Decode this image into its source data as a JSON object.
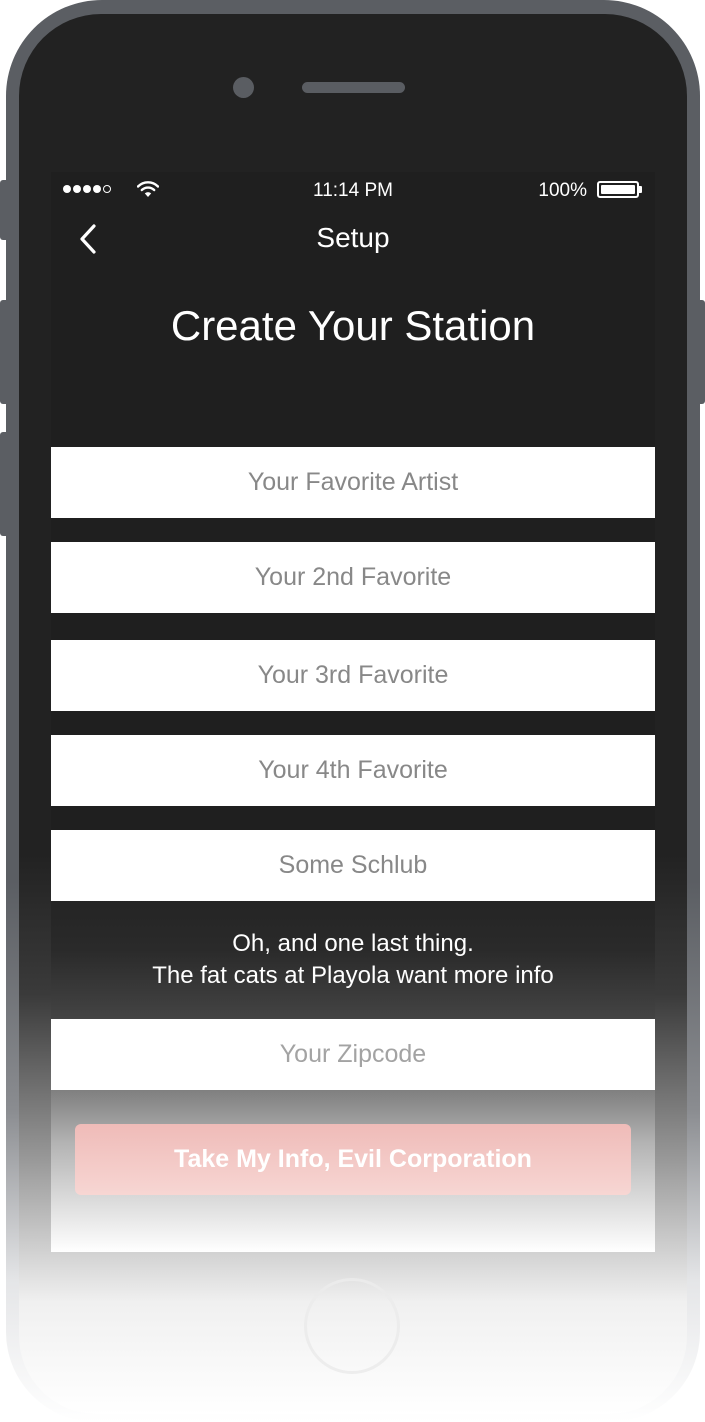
{
  "status_bar": {
    "time": "11:14 PM",
    "battery_percent": "100%",
    "signal_bars_filled": 4,
    "signal_bars_total": 5,
    "battery_level": 1.0
  },
  "nav": {
    "back_icon": "chevron-left-icon",
    "title": "Setup"
  },
  "page": {
    "title": "Create Your Station"
  },
  "form": {
    "artist_fields": [
      {
        "placeholder": "Your Favorite Artist",
        "value": ""
      },
      {
        "placeholder": "Your 2nd Favorite",
        "value": ""
      },
      {
        "placeholder": "Your 3rd Favorite",
        "value": ""
      },
      {
        "placeholder": "Your 4th Favorite",
        "value": ""
      },
      {
        "placeholder": "Some Schlub",
        "value": ""
      }
    ],
    "note_line1": "Oh, and one last thing.",
    "note_line2": "The fat cats at Playola want more info",
    "zipcode": {
      "placeholder": "Your Zipcode",
      "value": ""
    },
    "submit_label": "Take My Info, Evil Corporation"
  },
  "colors": {
    "screen_background": "#1f1f1f",
    "field_background": "#ffffff",
    "placeholder_text": "#888888",
    "button_accent": "#efbbb8",
    "phone_frame": "#5b5e63"
  }
}
